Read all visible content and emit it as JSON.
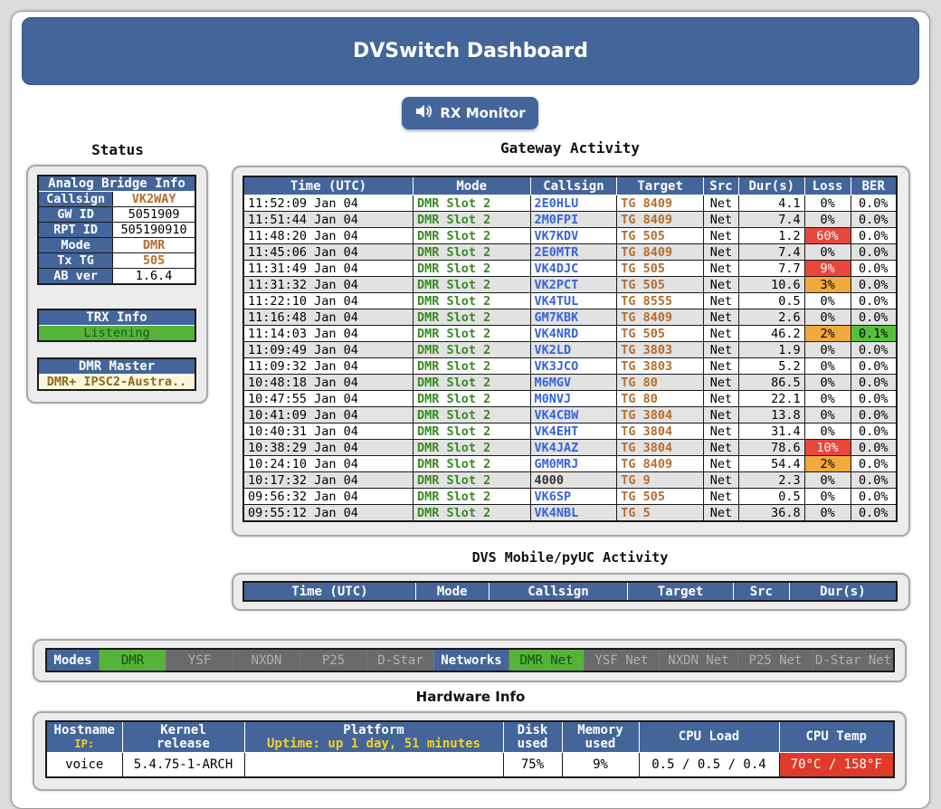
{
  "header": {
    "title": "DVSwitch Dashboard"
  },
  "rx_button": {
    "label": "RX Monitor",
    "icon": "speaker-icon"
  },
  "status": {
    "title": "Status",
    "analog_bridge": {
      "heading": "Analog Bridge Info",
      "rows": [
        {
          "label": "Callsign",
          "value": "VK2WAY"
        },
        {
          "label": "GW ID",
          "value": "5051909"
        },
        {
          "label": "RPT ID",
          "value": "505190910"
        },
        {
          "label": "Mode",
          "value": "DMR"
        },
        {
          "label": "Tx TG",
          "value": "505"
        },
        {
          "label": "AB ver",
          "value": "1.6.4"
        }
      ]
    },
    "trx": {
      "heading": "TRX Info",
      "value": "Listening"
    },
    "dmr_master": {
      "heading": "DMR Master",
      "value": "DMR+ IPSC2-Austra.."
    }
  },
  "gateway": {
    "title": "Gateway Activity",
    "columns": [
      "Time (UTC)",
      "Mode",
      "Callsign",
      "Target",
      "Src",
      "Dur(s)",
      "Loss",
      "BER"
    ],
    "rows": [
      [
        "11:52:09 Jan 04",
        "DMR Slot 2",
        "2E0HLU",
        "TG 8409",
        "Net",
        "4.1",
        "0%",
        "0.0%"
      ],
      [
        "11:51:44 Jan 04",
        "DMR Slot 2",
        "2M0FPI",
        "TG 8409",
        "Net",
        "7.4",
        "0%",
        "0.0%"
      ],
      [
        "11:48:20 Jan 04",
        "DMR Slot 2",
        "VK7KDV",
        "TG 505",
        "Net",
        "1.2",
        "60%",
        "0.0%"
      ],
      [
        "11:45:06 Jan 04",
        "DMR Slot 2",
        "2E0MTR",
        "TG 8409",
        "Net",
        "7.4",
        "0%",
        "0.0%"
      ],
      [
        "11:31:49 Jan 04",
        "DMR Slot 2",
        "VK4DJC",
        "TG 505",
        "Net",
        "7.7",
        "9%",
        "0.0%"
      ],
      [
        "11:31:32 Jan 04",
        "DMR Slot 2",
        "VK2PCT",
        "TG 505",
        "Net",
        "10.6",
        "3%",
        "0.0%"
      ],
      [
        "11:22:10 Jan 04",
        "DMR Slot 2",
        "VK4TUL",
        "TG 8555",
        "Net",
        "0.5",
        "0%",
        "0.0%"
      ],
      [
        "11:16:48 Jan 04",
        "DMR Slot 2",
        "GM7KBK",
        "TG 8409",
        "Net",
        "2.6",
        "0%",
        "0.0%"
      ],
      [
        "11:14:03 Jan 04",
        "DMR Slot 2",
        "VK4NRD",
        "TG 505",
        "Net",
        "46.2",
        "2%",
        "0.1%"
      ],
      [
        "11:09:49 Jan 04",
        "DMR Slot 2",
        "VK2LD",
        "TG 3803",
        "Net",
        "1.9",
        "0%",
        "0.0%"
      ],
      [
        "11:09:32 Jan 04",
        "DMR Slot 2",
        "VK3JCO",
        "TG 3803",
        "Net",
        "5.2",
        "0%",
        "0.0%"
      ],
      [
        "10:48:18 Jan 04",
        "DMR Slot 2",
        "M6MGV",
        "TG 80",
        "Net",
        "86.5",
        "0%",
        "0.0%"
      ],
      [
        "10:47:55 Jan 04",
        "DMR Slot 2",
        "M0NVJ",
        "TG 80",
        "Net",
        "22.1",
        "0%",
        "0.0%"
      ],
      [
        "10:41:09 Jan 04",
        "DMR Slot 2",
        "VK4CBW",
        "TG 3804",
        "Net",
        "13.8",
        "0%",
        "0.0%"
      ],
      [
        "10:40:31 Jan 04",
        "DMR Slot 2",
        "VK4EHT",
        "TG 3804",
        "Net",
        "31.4",
        "0%",
        "0.0%"
      ],
      [
        "10:38:29 Jan 04",
        "DMR Slot 2",
        "VK4JAZ",
        "TG 3804",
        "Net",
        "78.6",
        "10%",
        "0.0%"
      ],
      [
        "10:24:10 Jan 04",
        "DMR Slot 2",
        "GM0MRJ",
        "TG 8409",
        "Net",
        "54.4",
        "2%",
        "0.0%"
      ],
      [
        "10:17:32 Jan 04",
        "DMR Slot 2",
        "4000",
        "TG 9",
        "Net",
        "2.3",
        "0%",
        "0.0%"
      ],
      [
        "09:56:32 Jan 04",
        "DMR Slot 2",
        "VK6SP",
        "TG 505",
        "Net",
        "0.5",
        "0%",
        "0.0%"
      ],
      [
        "09:55:12 Jan 04",
        "DMR Slot 2",
        "VK4NBL",
        "TG 5",
        "Net",
        "36.8",
        "0%",
        "0.0%"
      ]
    ],
    "loss_highlight": {
      "60%": "red",
      "9%": "red",
      "10%": "red",
      "3%": "orange",
      "2%": "orange"
    },
    "ber_highlight": {
      "0.1%": "green"
    },
    "colors": {
      "red": "#e8473c",
      "orange": "#f1a93c",
      "green": "#56c03a"
    }
  },
  "mobile": {
    "title": "DVS Mobile/pyUC Activity",
    "columns": [
      "Time (UTC)",
      "Mode",
      "Callsign",
      "Target",
      "Src",
      "Dur(s)"
    ]
  },
  "modes_bar": {
    "modes_label": "Modes",
    "modes": [
      {
        "label": "DMR",
        "on": true
      },
      {
        "label": "YSF",
        "on": false
      },
      {
        "label": "NXDN",
        "on": false
      },
      {
        "label": "P25",
        "on": false
      },
      {
        "label": "D-Star",
        "on": false
      }
    ],
    "networks_label": "Networks",
    "networks": [
      {
        "label": "DMR Net",
        "on": true
      },
      {
        "label": "YSF Net",
        "on": false
      },
      {
        "label": "NXDN Net",
        "on": false
      },
      {
        "label": "P25 Net",
        "on": false
      },
      {
        "label": "D-Star Net",
        "on": false
      }
    ]
  },
  "hardware": {
    "title": "Hardware Info",
    "headers": {
      "hostname": "Hostname",
      "ip": "IP:",
      "kernel_1": "Kernel",
      "kernel_2": "release",
      "platform": "Platform",
      "uptime": "Uptime: up 1 day, 51 minutes",
      "disk_1": "Disk",
      "disk_2": "used",
      "memory_1": "Memory",
      "memory_2": "used",
      "cpu_load": "CPU Load",
      "cpu_temp": "CPU Temp"
    },
    "values": {
      "hostname": "voice",
      "kernel": "5.4.75-1-ARCH",
      "platform": "",
      "disk": "75%",
      "memory": "9%",
      "cpu_load": "0.5 / 0.5 / 0.4",
      "cpu_temp": "70°C / 158°F"
    }
  }
}
